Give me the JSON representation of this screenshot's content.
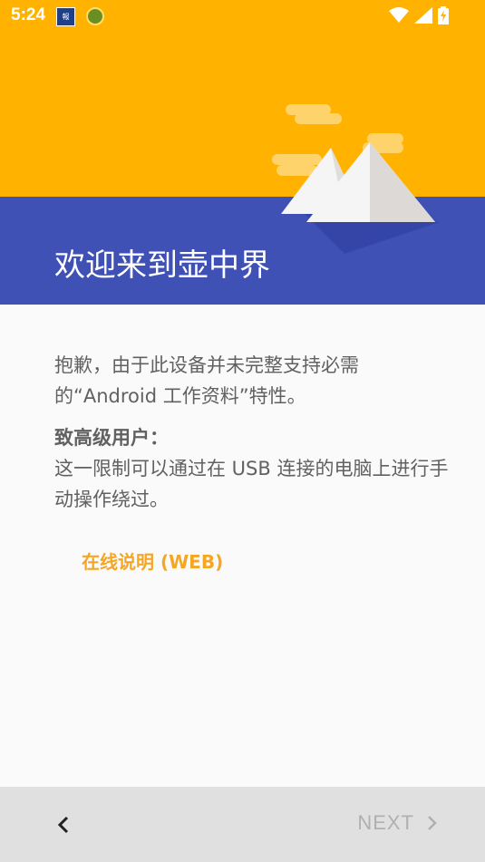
{
  "status_bar": {
    "time": "5:24",
    "notification_icons": [
      "news-app-icon",
      "game-app-icon"
    ],
    "system_icons": [
      "wifi-icon",
      "signal-icon",
      "battery-charging-icon"
    ]
  },
  "header": {
    "title": "欢迎来到壶中界",
    "colors": {
      "top": "#ffb300",
      "bottom": "#3f51b5"
    }
  },
  "content": {
    "paragraph1": "抱歉，由于此设备并未完整支持必需的“Android 工作资料”特性。",
    "paragraph2_heading": "致高级用户：",
    "paragraph2_body": "这一限制可以通过在 USB 连接的电脑上进行手动操作绕过。",
    "link_label": "在线说明 (WEB)",
    "link_color": "#f5a623"
  },
  "bottom_nav": {
    "next_label": "NEXT"
  }
}
